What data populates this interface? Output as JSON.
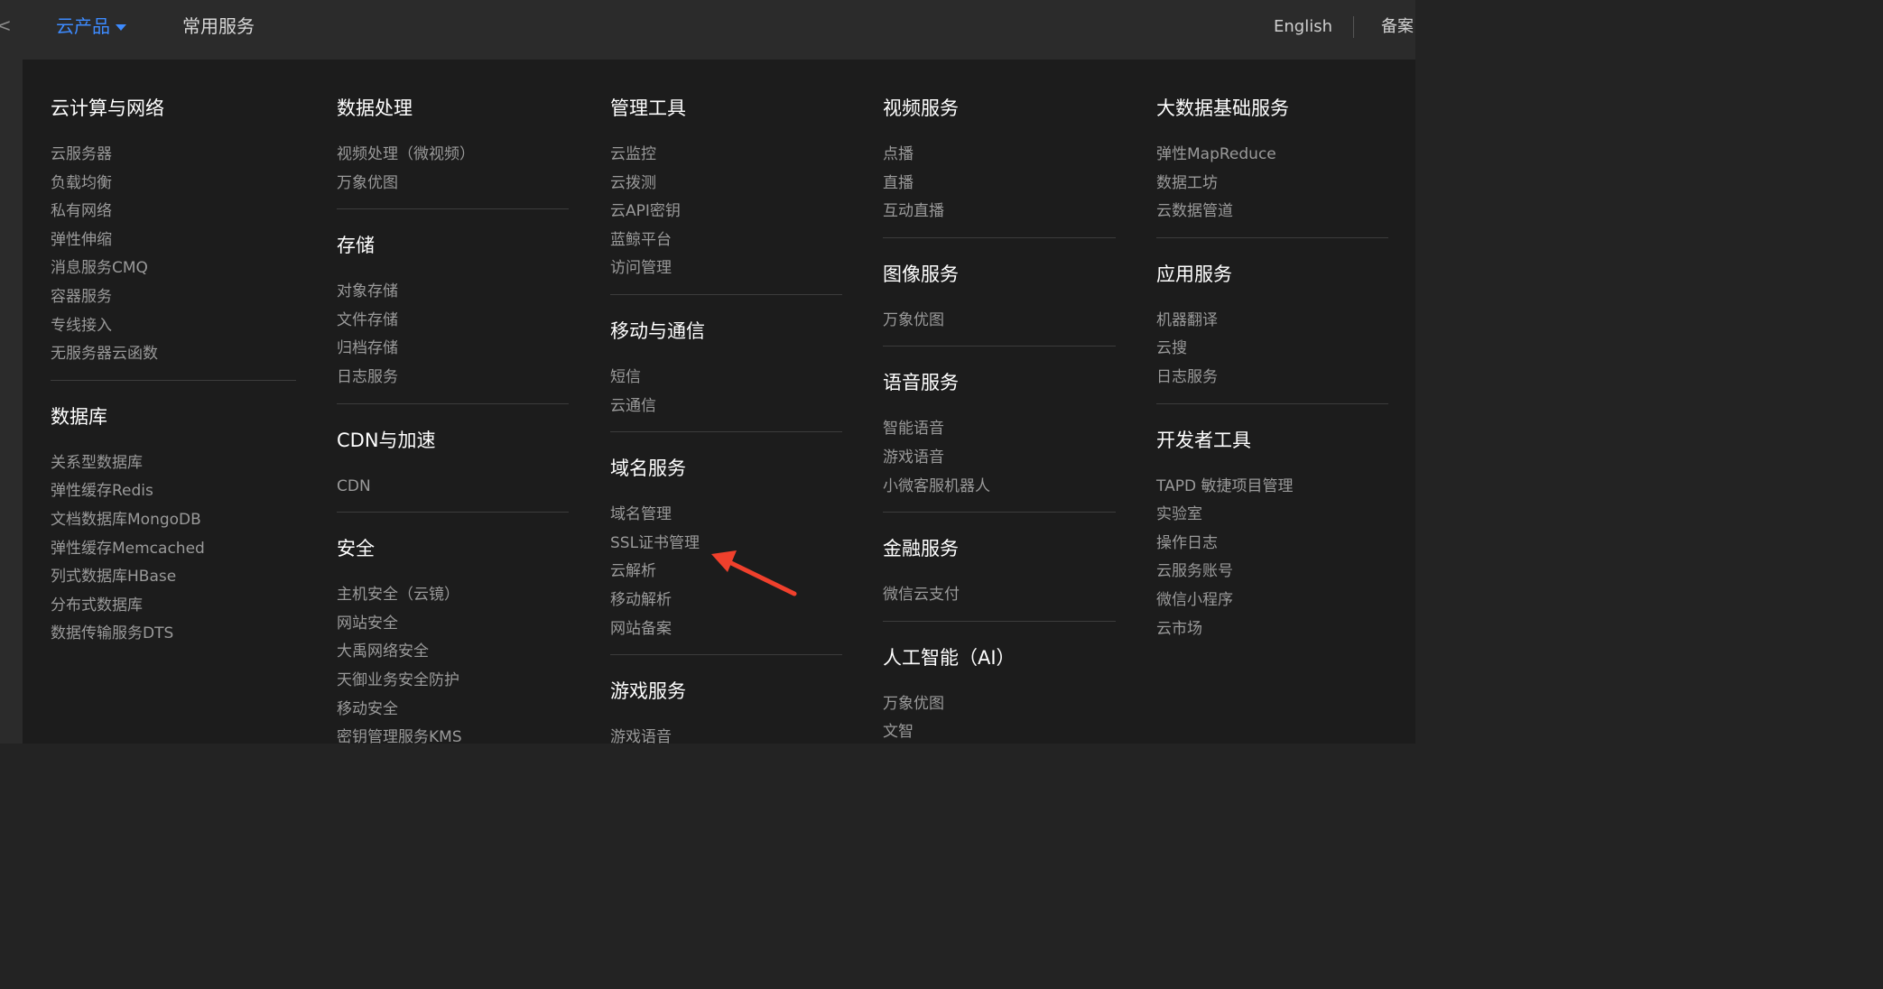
{
  "topbar": {
    "edge_glyph": "<",
    "products_label": "云产品",
    "common_label": "常用服务",
    "lang_label": "English",
    "record_label": "备案"
  },
  "columns": [
    {
      "sections": [
        {
          "title": "云计算与网络",
          "items": [
            "云服务器",
            "负载均衡",
            "私有网络",
            "弹性伸缩",
            "消息服务CMQ",
            "容器服务",
            "专线接入",
            "无服务器云函数"
          ]
        },
        {
          "title": "数据库",
          "items": [
            "关系型数据库",
            "弹性缓存Redis",
            "文档数据库MongoDB",
            "弹性缓存Memcached",
            "列式数据库HBase",
            "分布式数据库",
            "数据传输服务DTS"
          ]
        }
      ]
    },
    {
      "sections": [
        {
          "title": "数据处理",
          "items": [
            "视频处理（微视频）",
            "万象优图"
          ]
        },
        {
          "title": "存储",
          "items": [
            "对象存储",
            "文件存储",
            "归档存储",
            "日志服务"
          ]
        },
        {
          "title": "CDN与加速",
          "items": [
            "CDN"
          ]
        },
        {
          "title": "安全",
          "items": [
            "主机安全（云镜）",
            "网站安全",
            "大禹网络安全",
            "天御业务安全防护",
            "移动安全",
            "密钥管理服务KMS"
          ]
        }
      ]
    },
    {
      "sections": [
        {
          "title": "管理工具",
          "items": [
            "云监控",
            "云拨测",
            "云API密钥",
            "蓝鲸平台",
            "访问管理"
          ]
        },
        {
          "title": "移动与通信",
          "items": [
            "短信",
            "云通信"
          ]
        },
        {
          "title": "域名服务",
          "items": [
            "域名管理",
            "SSL证书管理",
            "云解析",
            "移动解析",
            "网站备案"
          ]
        },
        {
          "title": "游戏服务",
          "items": [
            "游戏语音"
          ]
        }
      ]
    },
    {
      "sections": [
        {
          "title": "视频服务",
          "items": [
            "点播",
            "直播",
            "互动直播"
          ]
        },
        {
          "title": "图像服务",
          "items": [
            "万象优图"
          ]
        },
        {
          "title": "语音服务",
          "items": [
            "智能语音",
            "游戏语音",
            "小微客服机器人"
          ]
        },
        {
          "title": "金融服务",
          "items": [
            "微信云支付"
          ]
        },
        {
          "title": "人工智能（AI）",
          "items": [
            "万象优图",
            "文智"
          ]
        }
      ]
    },
    {
      "sections": [
        {
          "title": "大数据基础服务",
          "items": [
            "弹性MapReduce",
            "数据工坊",
            "云数据管道"
          ]
        },
        {
          "title": "应用服务",
          "items": [
            "机器翻译",
            "云搜",
            "日志服务"
          ]
        },
        {
          "title": "开发者工具",
          "items": [
            "TAPD 敏捷项目管理",
            "实验室",
            "操作日志",
            "云服务账号",
            "微信小程序",
            "云市场"
          ]
        }
      ]
    }
  ],
  "colors": {
    "accent": "#3d8bff",
    "annotation_arrow": "#f0402c"
  }
}
